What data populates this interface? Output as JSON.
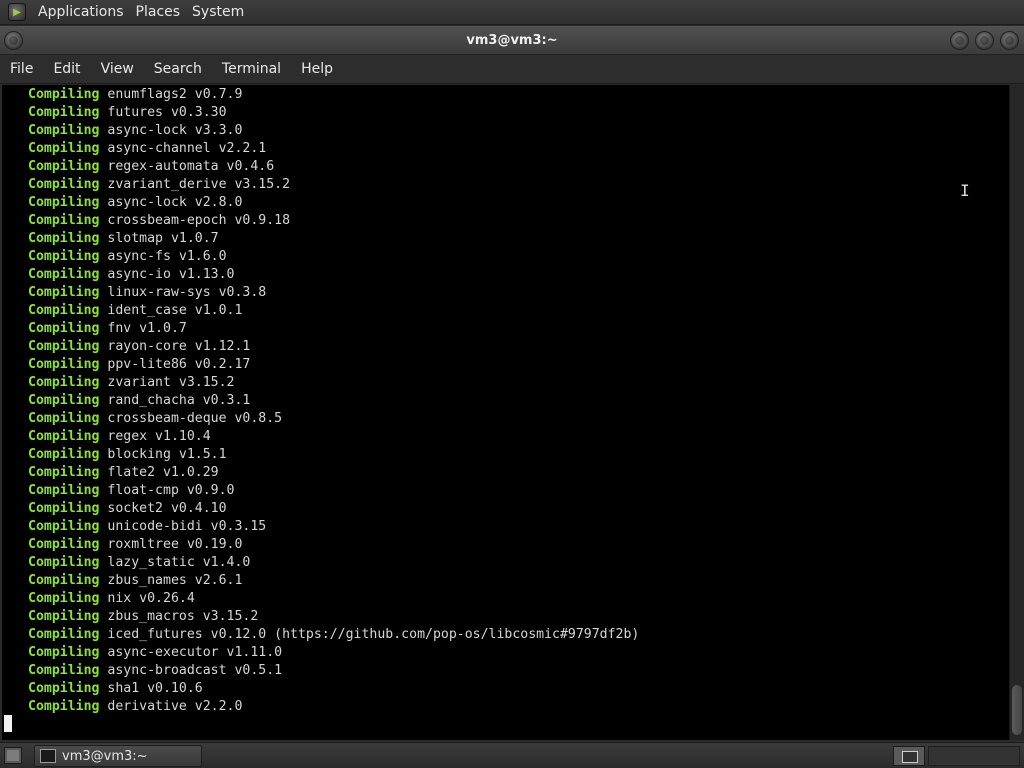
{
  "top_panel": {
    "menus": [
      "Applications",
      "Places",
      "System"
    ]
  },
  "window": {
    "title": "vm3@vm3:~"
  },
  "menubar": {
    "items": [
      "File",
      "Edit",
      "View",
      "Search",
      "Terminal",
      "Help"
    ]
  },
  "terminal": {
    "lines": [
      {
        "kw": "Compiling",
        "text": "enumflags2 v0.7.9"
      },
      {
        "kw": "Compiling",
        "text": "futures v0.3.30"
      },
      {
        "kw": "Compiling",
        "text": "async-lock v3.3.0"
      },
      {
        "kw": "Compiling",
        "text": "async-channel v2.2.1"
      },
      {
        "kw": "Compiling",
        "text": "regex-automata v0.4.6"
      },
      {
        "kw": "Compiling",
        "text": "zvariant_derive v3.15.2"
      },
      {
        "kw": "Compiling",
        "text": "async-lock v2.8.0"
      },
      {
        "kw": "Compiling",
        "text": "crossbeam-epoch v0.9.18"
      },
      {
        "kw": "Compiling",
        "text": "slotmap v1.0.7"
      },
      {
        "kw": "Compiling",
        "text": "async-fs v1.6.0"
      },
      {
        "kw": "Compiling",
        "text": "async-io v1.13.0"
      },
      {
        "kw": "Compiling",
        "text": "linux-raw-sys v0.3.8"
      },
      {
        "kw": "Compiling",
        "text": "ident_case v1.0.1"
      },
      {
        "kw": "Compiling",
        "text": "fnv v1.0.7"
      },
      {
        "kw": "Compiling",
        "text": "rayon-core v1.12.1"
      },
      {
        "kw": "Compiling",
        "text": "ppv-lite86 v0.2.17"
      },
      {
        "kw": "Compiling",
        "text": "zvariant v3.15.2"
      },
      {
        "kw": "Compiling",
        "text": "rand_chacha v0.3.1"
      },
      {
        "kw": "Compiling",
        "text": "crossbeam-deque v0.8.5"
      },
      {
        "kw": "Compiling",
        "text": "regex v1.10.4"
      },
      {
        "kw": "Compiling",
        "text": "blocking v1.5.1"
      },
      {
        "kw": "Compiling",
        "text": "flate2 v1.0.29"
      },
      {
        "kw": "Compiling",
        "text": "float-cmp v0.9.0"
      },
      {
        "kw": "Compiling",
        "text": "socket2 v0.4.10"
      },
      {
        "kw": "Compiling",
        "text": "unicode-bidi v0.3.15"
      },
      {
        "kw": "Compiling",
        "text": "roxmltree v0.19.0"
      },
      {
        "kw": "Compiling",
        "text": "lazy_static v1.4.0"
      },
      {
        "kw": "Compiling",
        "text": "zbus_names v2.6.1"
      },
      {
        "kw": "Compiling",
        "text": "nix v0.26.4"
      },
      {
        "kw": "Compiling",
        "text": "zbus_macros v3.15.2"
      },
      {
        "kw": "Compiling",
        "text": "iced_futures v0.12.0 (https://github.com/pop-os/libcosmic#9797df2b)"
      },
      {
        "kw": "Compiling",
        "text": "async-executor v1.11.0"
      },
      {
        "kw": "Compiling",
        "text": "async-broadcast v0.5.1"
      },
      {
        "kw": "Compiling",
        "text": "sha1 v0.10.6"
      },
      {
        "kw": "Compiling",
        "text": "derivative v2.2.0"
      }
    ]
  },
  "taskbar": {
    "task_label": "vm3@vm3:~"
  },
  "colors": {
    "keyword": "#8ae234",
    "terminal_bg": "#000000",
    "terminal_fg": "#d6d6d6"
  },
  "icons": {
    "panel_logo": "gnome-foot-icon",
    "terminal_task": "terminal-icon"
  }
}
